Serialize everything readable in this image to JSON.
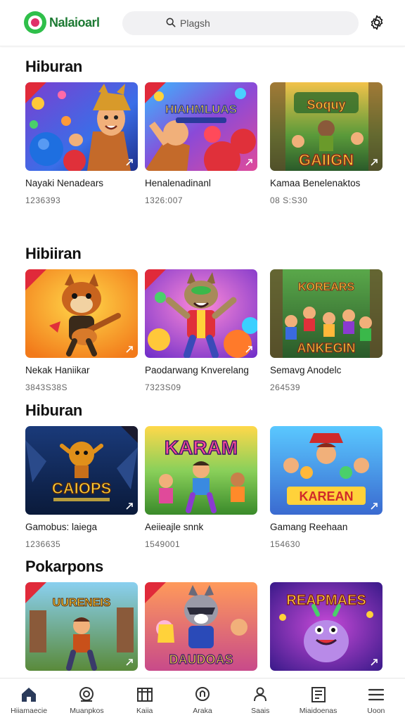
{
  "header": {
    "brand": "Nalaioarl",
    "search_placeholder": "Plagsh",
    "brand_color": "#2fbf4a",
    "accent_color": "#e0306a"
  },
  "sections": [
    {
      "title": "Hiburan",
      "items": [
        {
          "title": "Nayaki Nenadears",
          "meta": "1236393",
          "art": "fantasy-hero",
          "badge": "red"
        },
        {
          "title": "Henalenadinanl",
          "meta": "1326:007",
          "art": "marble-hero",
          "art_text": "HIAHMLUAS",
          "badge": "red"
        },
        {
          "title": "Kamaa Benelenaktos",
          "meta": "08 S:S30",
          "art": "jungle-adventure",
          "art_text": "GAIIGN",
          "badge": "none"
        }
      ]
    },
    {
      "title": "Hibiiran",
      "items": [
        {
          "title": "Nekak Haniikar",
          "meta": "3843S38S",
          "art": "guitar-fox",
          "badge": "red"
        },
        {
          "title": "Paodarwang Knverelang",
          "meta": "7323S09",
          "art": "party-fox",
          "badge": "red"
        },
        {
          "title": "Semavg Anodelc",
          "meta": "264539",
          "art": "forest-crew",
          "art_text": "ANKEGIN",
          "badge": "none"
        }
      ]
    },
    {
      "title": "Hiburan",
      "items": [
        {
          "title": "Gamobus: laiega",
          "meta": "1236635",
          "art": "cave-hero",
          "art_text": "CAIOPS",
          "badge": "dark"
        },
        {
          "title": "Aeiieajle snnk",
          "meta": "1549001",
          "art": "kids-dance",
          "art_text": "KARAM",
          "badge": "none"
        },
        {
          "title": "Gamang Reehaan",
          "meta": "154630",
          "art": "pirate-crew",
          "art_text": "KAREAN",
          "badge": "none"
        }
      ]
    },
    {
      "title": "Pokarpons",
      "items": [
        {
          "title": "",
          "meta": "",
          "art": "town-hero",
          "art_text": "UURENEIS",
          "badge": "red"
        },
        {
          "title": "",
          "meta": "",
          "art": "raccoon-crew",
          "art_text": "DAUDOAS",
          "badge": "red"
        },
        {
          "title": "",
          "meta": "",
          "art": "purple-monster",
          "art_text": "REAPMAES",
          "badge": "none"
        }
      ]
    }
  ],
  "bottom_nav": [
    {
      "label": "Hiiamaecie",
      "icon": "home-icon"
    },
    {
      "label": "Muanpkos",
      "icon": "controller-icon"
    },
    {
      "label": "Kaiia",
      "icon": "grid-icon"
    },
    {
      "label": "Araka",
      "icon": "badge-icon"
    },
    {
      "label": "Saais",
      "icon": "user-icon"
    },
    {
      "label": "Miaidoenas",
      "icon": "library-icon"
    },
    {
      "label": "Uoon",
      "icon": "menu-icon"
    }
  ]
}
